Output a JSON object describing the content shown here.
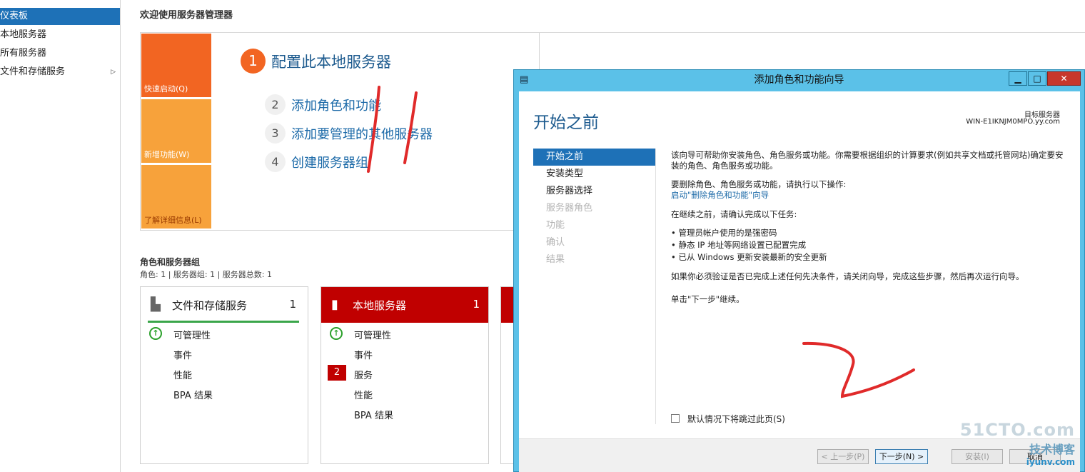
{
  "nav": {
    "items": [
      {
        "label": "仪表板",
        "active": true
      },
      {
        "label": "本地服务器"
      },
      {
        "label": "所有服务器"
      },
      {
        "label": "文件和存储服务",
        "has_arrow": true
      }
    ]
  },
  "welcome": {
    "title": "欢迎使用服务器管理器",
    "tiles": [
      "快速启动(Q)",
      "新增功能(W)",
      "了解详细信息(L)"
    ],
    "step1": {
      "num": "1",
      "label": "配置此本地服务器"
    },
    "steps": [
      {
        "num": "2",
        "label": "添加角色和功能"
      },
      {
        "num": "3",
        "label": "添加要管理的其他服务器"
      },
      {
        "num": "4",
        "label": "创建服务器组"
      }
    ]
  },
  "groups": {
    "title": "角色和服务器组",
    "subtitle": "角色: 1 | 服务器组: 1 | 服务器总数: 1",
    "cards": [
      {
        "title": "文件和存储服务",
        "count": "1",
        "icon": "folder-server-icon",
        "rows": [
          "可管理性",
          "事件",
          "性能",
          "BPA 结果"
        ]
      },
      {
        "title": "本地服务器",
        "count": "1",
        "icon": "server-icon",
        "rows": [
          "可管理性",
          "事件",
          "服务",
          "性能",
          "BPA 结果"
        ],
        "badge": "2"
      }
    ]
  },
  "wizard": {
    "title": "添加角色和功能向导",
    "heading": "开始之前",
    "target_label": "目标服务器",
    "target_value": "WIN-E1IKNJM0MPO.yy.com",
    "nav": [
      {
        "label": "开始之前",
        "state": "active"
      },
      {
        "label": "安装类型",
        "state": "enabled"
      },
      {
        "label": "服务器选择",
        "state": "enabled"
      },
      {
        "label": "服务器角色",
        "state": "disabled"
      },
      {
        "label": "功能",
        "state": "disabled"
      },
      {
        "label": "确认",
        "state": "disabled"
      },
      {
        "label": "结果",
        "state": "disabled"
      }
    ],
    "content": {
      "p1": "该向导可帮助你安装角色、角色服务或功能。你需要根据组织的计算要求(例如共享文档或托管网站)确定要安装的角色、角色服务或功能。",
      "p2": "要删除角色、角色服务或功能，请执行以下操作:",
      "p2_link": "启动\"删除角色和功能\"向导",
      "p3": "在继续之前，请确认完成以下任务:",
      "bullets": [
        "管理员帐户使用的是强密码",
        "静态 IP 地址等网络设置已配置完成",
        "已从 Windows 更新安装最新的安全更新"
      ],
      "p4": "如果你必须验证是否已完成上述任何先决条件，请关闭向导，完成这些步骤，然后再次运行向导。",
      "p5": "单击\"下一步\"继续。"
    },
    "skip_label": "默认情况下将跳过此页(S)",
    "buttons": {
      "prev": "< 上一步(P)",
      "next": "下一步(N) >",
      "install": "安装(I)",
      "cancel": "取消"
    }
  },
  "watermark": {
    "line1": "51CTO.com",
    "line2": "技术博客",
    "line3": "iyunv.com"
  },
  "colors": {
    "accent_blue": "#1e71b7",
    "quick_orange": "#f26522",
    "tile_orange": "#f7a23b",
    "alert_red": "#c00000",
    "dialog_frame": "#5bc1e8",
    "annotation_red": "#e02a2a"
  }
}
